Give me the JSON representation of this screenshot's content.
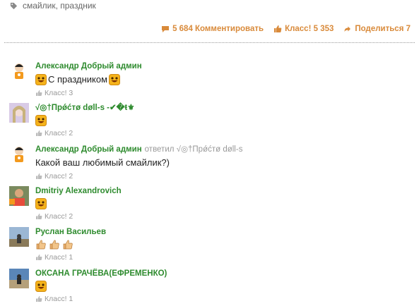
{
  "tags": {
    "text": "смайлик, праздник"
  },
  "actions": {
    "comments": "5 684 Комментировать",
    "like": "Класс! 5 353",
    "share": "Поделиться 7"
  },
  "comments": [
    {
      "author": "Александр Добрый админ",
      "reply_label": "",
      "reply_to": "",
      "text": "С праздником",
      "like": "Класс! 3"
    },
    {
      "author": "√◎†Прǿćтø døll-s -✔�ŧ⚜",
      "reply_label": "",
      "reply_to": "",
      "text": "",
      "like": "Класс! 2"
    },
    {
      "author": "Александр Добрый админ",
      "reply_label": "ответил",
      "reply_to": "√◎†Прǿćтø døll-s",
      "text": "Какой ваш любимый смайлик?)",
      "like": "Класс! 2"
    },
    {
      "author": "Dmitriy Alexandrovich",
      "reply_label": "",
      "reply_to": "",
      "text": "",
      "like": "Класс! 2"
    },
    {
      "author": "Руслан Васильев",
      "reply_label": "",
      "reply_to": "",
      "text": "",
      "like": "Класс! 1"
    },
    {
      "author": "ОКСАНА ГРАЧЁВА(ЕФРЕМЕНКО)",
      "reply_label": "",
      "reply_to": "",
      "text": "",
      "like": "Класс! 1"
    }
  ],
  "colors": {
    "accent": "#d98a3a",
    "author": "#2e8b2e",
    "muted": "#999999"
  }
}
